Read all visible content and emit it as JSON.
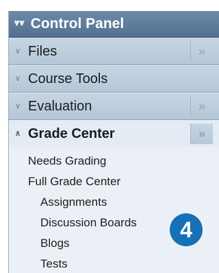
{
  "control_panel": {
    "title": "Control Panel",
    "collapse_icon": "chevron-up-double",
    "sections": [
      {
        "label": "Files",
        "icon": "chevron-down-double",
        "arrow": "»"
      },
      {
        "label": "Course Tools",
        "icon": "chevron-down-double",
        "arrow": ""
      },
      {
        "label": "Evaluation",
        "icon": "chevron-down-double",
        "arrow": "»"
      },
      {
        "label": "Grade Center",
        "icon": "chevron-up-double",
        "arrow": "»"
      }
    ],
    "grade_center_items": [
      {
        "label": "Needs Grading"
      },
      {
        "label": "Full Grade Center"
      },
      {
        "label": "Assignments"
      },
      {
        "label": "Discussion Boards"
      },
      {
        "label": "Blogs"
      },
      {
        "label": "Tests"
      }
    ]
  },
  "step_badge": {
    "number": "4",
    "color": "#1670b5"
  },
  "colors": {
    "header": "#5f7c9b",
    "section": "#bfcfdf",
    "active_bg": "#e4ecf3"
  }
}
